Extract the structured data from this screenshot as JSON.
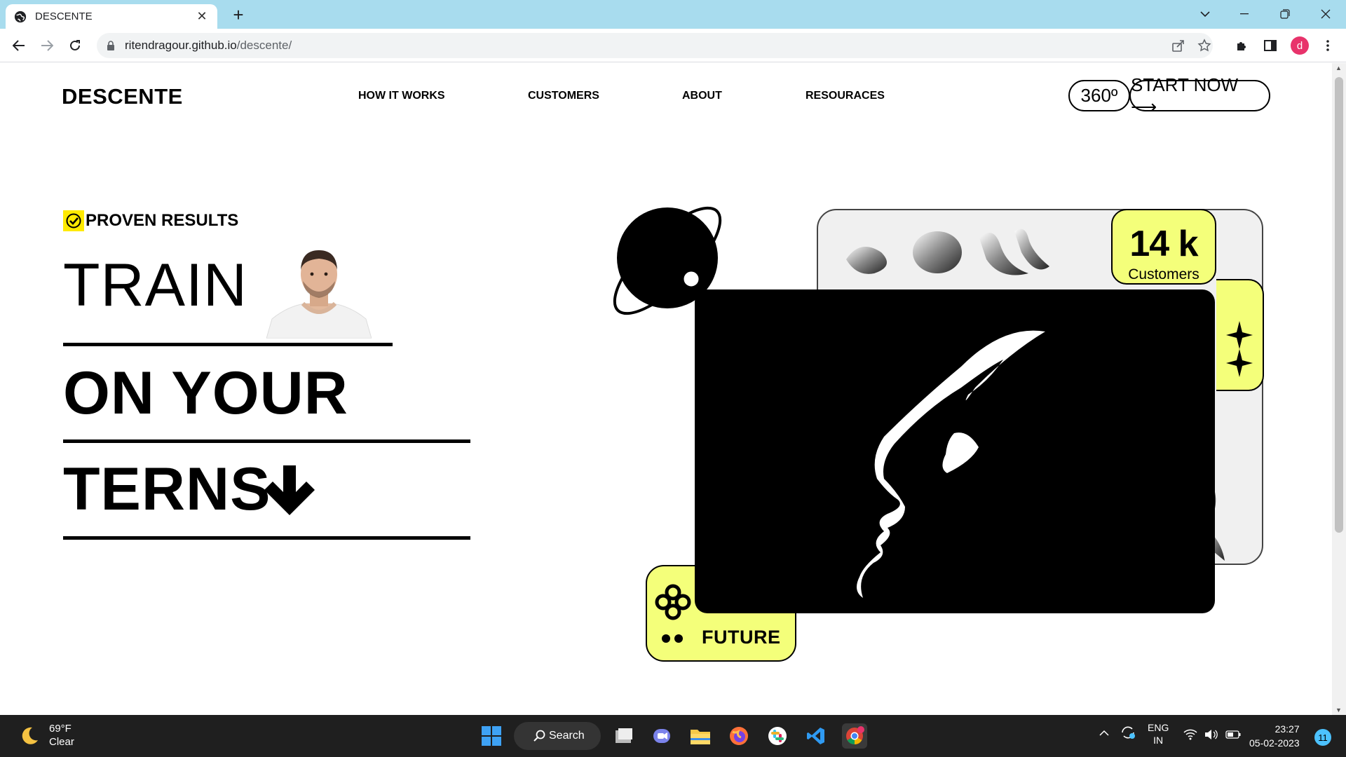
{
  "browser": {
    "tab_title": "DESCENTE",
    "url_host": "ritendragour.github.io",
    "url_path": "/descente/",
    "profile_initial": "d"
  },
  "site": {
    "logo": "DESCENTE",
    "nav": [
      "HOW IT WORKS",
      "CUSTOMERS",
      "ABOUT",
      "RESOURACES"
    ],
    "pill_360": "360º",
    "start_now": "START NOW ⟶"
  },
  "hero": {
    "eyebrow": "PROVEN RESULTS",
    "line1": "TRAIN",
    "line2": "ON YOUR",
    "line3": "TERNS"
  },
  "art": {
    "customers_count": "14 k",
    "customers_label": "Customers",
    "future_label": "FUTURE",
    "accent_yellow": "#f4ff7a"
  },
  "taskbar": {
    "temp": "69°F",
    "condition": "Clear",
    "search_label": "Search",
    "lang1": "ENG",
    "lang2": "IN",
    "time": "23:27",
    "date": "05-02-2023",
    "notifications": "11"
  }
}
